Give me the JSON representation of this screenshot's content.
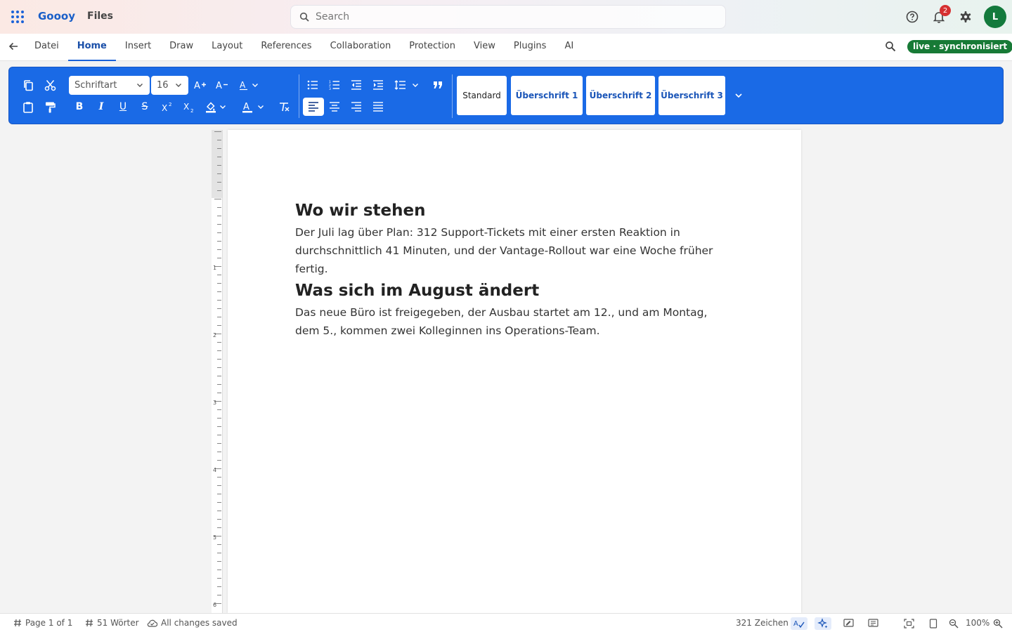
{
  "app": {
    "brand": "Goooy",
    "section": "Files"
  },
  "search": {
    "placeholder": "Search"
  },
  "notifications": {
    "count": "2"
  },
  "user": {
    "initial": "L"
  },
  "menu": {
    "tabs": [
      "Datei",
      "Home",
      "Insert",
      "Draw",
      "Layout",
      "References",
      "Collaboration",
      "Protection",
      "View",
      "Plugins",
      "AI"
    ],
    "active_tab": "Home",
    "sync_status": "live · synchronisiert"
  },
  "ribbon": {
    "font_family": "Schriftart",
    "font_size": "16",
    "styles": [
      "Standard",
      "Überschrift 1",
      "Überschrift 2",
      "Überschrift 3"
    ],
    "active_alignment": "left"
  },
  "ruler": {
    "marks": [
      "1",
      "2",
      "3",
      "4",
      "5",
      "6"
    ]
  },
  "document": {
    "heading1": "Wo wir stehen",
    "para1": "Der Juli lag über Plan: 312 Support-Tickets mit einer ersten Reaktion in durchschnittlich 41 Minuten, und der Vantage-Rollout war eine Woche früher fertig.",
    "heading2": "Was sich im August ändert",
    "para2": "Das neue Büro ist freigegeben, der Ausbau startet am 12., und am Montag, dem 5., kommen zwei Kolleginnen ins Operations-Team."
  },
  "status": {
    "page": "Page 1 of 1",
    "words": "51 Wörter",
    "saved": "All changes saved",
    "chars": "321 Zeichen",
    "zoom": "100%"
  },
  "colors": {
    "accent": "#1a6ae6",
    "live": "#177a36",
    "badge": "#d63031",
    "avatar": "#137a3c"
  }
}
